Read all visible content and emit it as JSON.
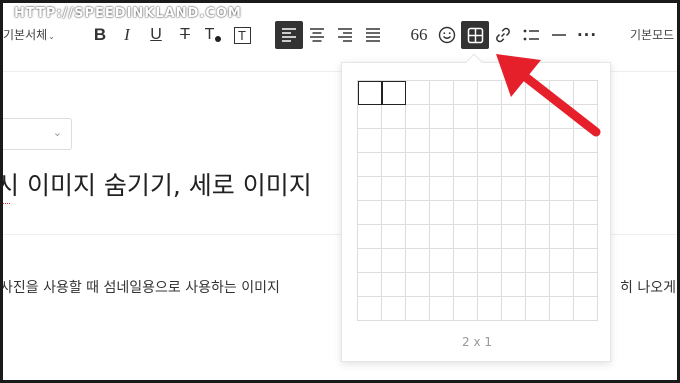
{
  "watermark": "HTTP://SPEEDINKLAND.COM",
  "toolbar": {
    "font_select_label": "기본서체",
    "bold_label": "B",
    "italic_label": "I",
    "underline_label": "U",
    "strike_label": "T",
    "text_color_label": "T",
    "bg_color_label": "T",
    "quote_label": "66",
    "more_label": "···",
    "mode_label": "기본모드"
  },
  "category": {
    "value": ""
  },
  "post": {
    "title": "시 이미지 숨기기, 세로 이미지",
    "body_left": "사진을 사용할 때 섬네일용으로 사용하는 이미지",
    "body_right": "히 나오게"
  },
  "table_popup": {
    "rows": 10,
    "cols": 10,
    "selected_rows": 1,
    "selected_cols": 2,
    "size_label": "2 x 1"
  },
  "colors": {
    "accent_dark": "#333333",
    "arrow_red": "#e5202a",
    "grid_line": "#dddddd"
  }
}
